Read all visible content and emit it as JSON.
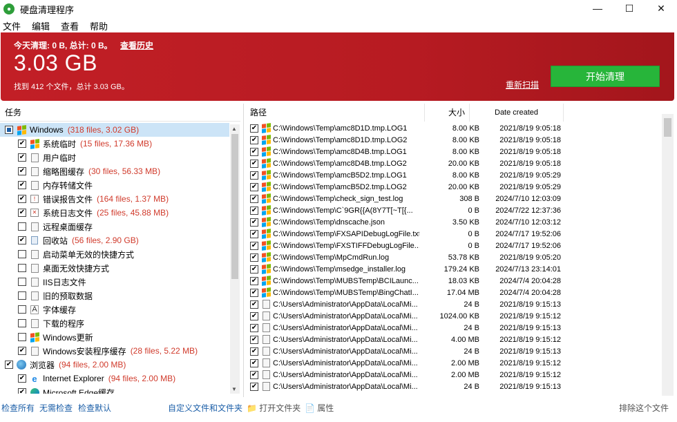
{
  "window": {
    "title": "硬盘清理程序"
  },
  "menu": [
    "文件",
    "编辑",
    "查看",
    "帮助"
  ],
  "banner": {
    "today_text": "今天清理: 0 B, 总计: 0 B。",
    "history_link": "查看历史",
    "total_size": "3.03 GB",
    "found_text": "找到 412 个文件，总计 3.03 GB。",
    "rescan_link": "重新扫描",
    "start_button": "开始清理",
    "color": "#b71b22",
    "start_color": "#27b53a"
  },
  "left_panel": {
    "header": "任务",
    "items": [
      {
        "label": "Windows",
        "stat": "(318 files, 3.02 GB)",
        "state": "partial",
        "level": 0,
        "icon": "windows-icon",
        "selected": true
      },
      {
        "label": "系统临时",
        "stat": "(15 files, 17.36 MB)",
        "state": "checked",
        "level": 1,
        "icon": "windows-icon"
      },
      {
        "label": "用户临时",
        "stat": "",
        "state": "checked",
        "level": 1,
        "icon": "document-icon"
      },
      {
        "label": "缩略图缓存",
        "stat": "(30 files, 56.33 MB)",
        "state": "checked",
        "level": 1,
        "icon": "thumbnail-icon"
      },
      {
        "label": "内存转储文件",
        "stat": "",
        "state": "checked",
        "level": 1,
        "icon": "memory-dump-icon"
      },
      {
        "label": "错误报告文件",
        "stat": "(164 files, 1.37 MB)",
        "state": "checked",
        "level": 1,
        "icon": "error-report-icon"
      },
      {
        "label": "系统日志文件",
        "stat": "(25 files, 45.88 MB)",
        "state": "checked",
        "level": 1,
        "icon": "log-icon"
      },
      {
        "label": "远程桌面缓存",
        "stat": "",
        "state": "unchecked",
        "level": 1,
        "icon": "remote-desktop-icon"
      },
      {
        "label": "回收站",
        "stat": "(56 files, 2.90 GB)",
        "state": "checked",
        "level": 1,
        "icon": "recycle-bin-icon"
      },
      {
        "label": "启动菜单无效的快捷方式",
        "stat": "",
        "state": "unchecked",
        "level": 1,
        "icon": "shortcut-icon"
      },
      {
        "label": "桌面无效快捷方式",
        "stat": "",
        "state": "unchecked",
        "level": 1,
        "icon": "desktop-shortcut-icon"
      },
      {
        "label": "IIS日志文件",
        "stat": "",
        "state": "unchecked",
        "level": 1,
        "icon": "document-icon"
      },
      {
        "label": "旧的预取数据",
        "stat": "",
        "state": "unchecked",
        "level": 1,
        "icon": "document-icon"
      },
      {
        "label": "字体缓存",
        "stat": "",
        "state": "unchecked",
        "level": 1,
        "icon": "font-icon"
      },
      {
        "label": "下载的程序",
        "stat": "",
        "state": "unchecked",
        "level": 1,
        "icon": "program-icon"
      },
      {
        "label": "Windows更新",
        "stat": "",
        "state": "unchecked",
        "level": 1,
        "icon": "windows-icon"
      },
      {
        "label": "Windows安装程序缓存",
        "stat": "(28 files, 5.22 MB)",
        "state": "checked",
        "level": 1,
        "icon": "installer-icon"
      },
      {
        "label": "浏览器",
        "stat": "(94 files, 2.00 MB)",
        "state": "checked",
        "level": 0,
        "icon": "globe-icon"
      },
      {
        "label": "Internet Explorer",
        "stat": "(94 files, 2.00 MB)",
        "state": "checked",
        "level": 1,
        "icon": "ie-icon"
      },
      {
        "label": "Microsoft Edge缓存",
        "stat": "",
        "state": "checked",
        "level": 1,
        "icon": "edge-icon"
      }
    ]
  },
  "right_panel": {
    "columns": {
      "path": "路径",
      "size": "大小",
      "date": "Date created"
    },
    "rows": [
      {
        "path": "C:\\Windows\\Temp\\amc8D1D.tmp.LOG1",
        "size": "8.00 KB",
        "date": "2021/8/19 9:05:18",
        "icon": "windows-icon"
      },
      {
        "path": "C:\\Windows\\Temp\\amc8D1D.tmp.LOG2",
        "size": "8.00 KB",
        "date": "2021/8/19 9:05:18",
        "icon": "windows-icon"
      },
      {
        "path": "C:\\Windows\\Temp\\amc8D4B.tmp.LOG1",
        "size": "8.00 KB",
        "date": "2021/8/19 9:05:18",
        "icon": "windows-icon"
      },
      {
        "path": "C:\\Windows\\Temp\\amc8D4B.tmp.LOG2",
        "size": "20.00 KB",
        "date": "2021/8/19 9:05:18",
        "icon": "windows-icon"
      },
      {
        "path": "C:\\Windows\\Temp\\amcB5D2.tmp.LOG1",
        "size": "8.00 KB",
        "date": "2021/8/19 9:05:29",
        "icon": "windows-icon"
      },
      {
        "path": "C:\\Windows\\Temp\\amcB5D2.tmp.LOG2",
        "size": "20.00 KB",
        "date": "2021/8/19 9:05:29",
        "icon": "windows-icon"
      },
      {
        "path": "C:\\Windows\\Temp\\check_sign_test.log",
        "size": "308 B",
        "date": "2024/7/10 12:03:09",
        "icon": "windows-icon"
      },
      {
        "path": "C:\\Windows\\Temp\\C`9GR{{A(8Y7T[~T[{...",
        "size": "0 B",
        "date": "2024/7/22 12:37:36",
        "icon": "windows-icon"
      },
      {
        "path": "C:\\Windows\\Temp\\dnscache.json",
        "size": "3.50 KB",
        "date": "2024/7/10 12:03:12",
        "icon": "windows-icon"
      },
      {
        "path": "C:\\Windows\\Temp\\FXSAPIDebugLogFile.txt",
        "size": "0 B",
        "date": "2024/7/17 19:52:06",
        "icon": "windows-icon"
      },
      {
        "path": "C:\\Windows\\Temp\\FXSTIFFDebugLogFile...",
        "size": "0 B",
        "date": "2024/7/17 19:52:06",
        "icon": "windows-icon"
      },
      {
        "path": "C:\\Windows\\Temp\\MpCmdRun.log",
        "size": "53.78 KB",
        "date": "2021/8/19 9:05:20",
        "icon": "windows-icon"
      },
      {
        "path": "C:\\Windows\\Temp\\msedge_installer.log",
        "size": "179.24 KB",
        "date": "2024/7/13 23:14:01",
        "icon": "windows-icon"
      },
      {
        "path": "C:\\Windows\\Temp\\MUBSTemp\\BCILaunc...",
        "size": "18.03 KB",
        "date": "2024/7/4 20:04:28",
        "icon": "windows-icon"
      },
      {
        "path": "C:\\Windows\\Temp\\MUBSTemp\\BingChatI...",
        "size": "17.04 MB",
        "date": "2024/7/4 20:04:28",
        "icon": "windows-icon"
      },
      {
        "path": "C:\\Users\\Administrator\\AppData\\Local\\Mi...",
        "size": "24 B",
        "date": "2021/8/19 9:15:13",
        "icon": "thumbnail-icon"
      },
      {
        "path": "C:\\Users\\Administrator\\AppData\\Local\\Mi...",
        "size": "1024.00 KB",
        "date": "2021/8/19 9:15:12",
        "icon": "thumbnail-icon"
      },
      {
        "path": "C:\\Users\\Administrator\\AppData\\Local\\Mi...",
        "size": "24 B",
        "date": "2021/8/19 9:15:13",
        "icon": "thumbnail-icon"
      },
      {
        "path": "C:\\Users\\Administrator\\AppData\\Local\\Mi...",
        "size": "4.00 MB",
        "date": "2021/8/19 9:15:12",
        "icon": "thumbnail-icon"
      },
      {
        "path": "C:\\Users\\Administrator\\AppData\\Local\\Mi...",
        "size": "24 B",
        "date": "2021/8/19 9:15:13",
        "icon": "thumbnail-icon"
      },
      {
        "path": "C:\\Users\\Administrator\\AppData\\Local\\Mi...",
        "size": "2.00 MB",
        "date": "2021/8/19 9:15:12",
        "icon": "thumbnail-icon"
      },
      {
        "path": "C:\\Users\\Administrator\\AppData\\Local\\Mi...",
        "size": "2.00 MB",
        "date": "2021/8/19 9:15:12",
        "icon": "thumbnail-icon"
      },
      {
        "path": "C:\\Users\\Administrator\\AppData\\Local\\Mi...",
        "size": "24 B",
        "date": "2021/8/19 9:15:13",
        "icon": "thumbnail-icon"
      }
    ]
  },
  "footer": {
    "check_all": "检查所有",
    "check_none": "无需检查",
    "check_default": "检查默认",
    "custom_files": "自定义文件和文件夹",
    "open_folder": "打开文件夹",
    "properties": "属性",
    "exclude_file": "排除这个文件"
  }
}
